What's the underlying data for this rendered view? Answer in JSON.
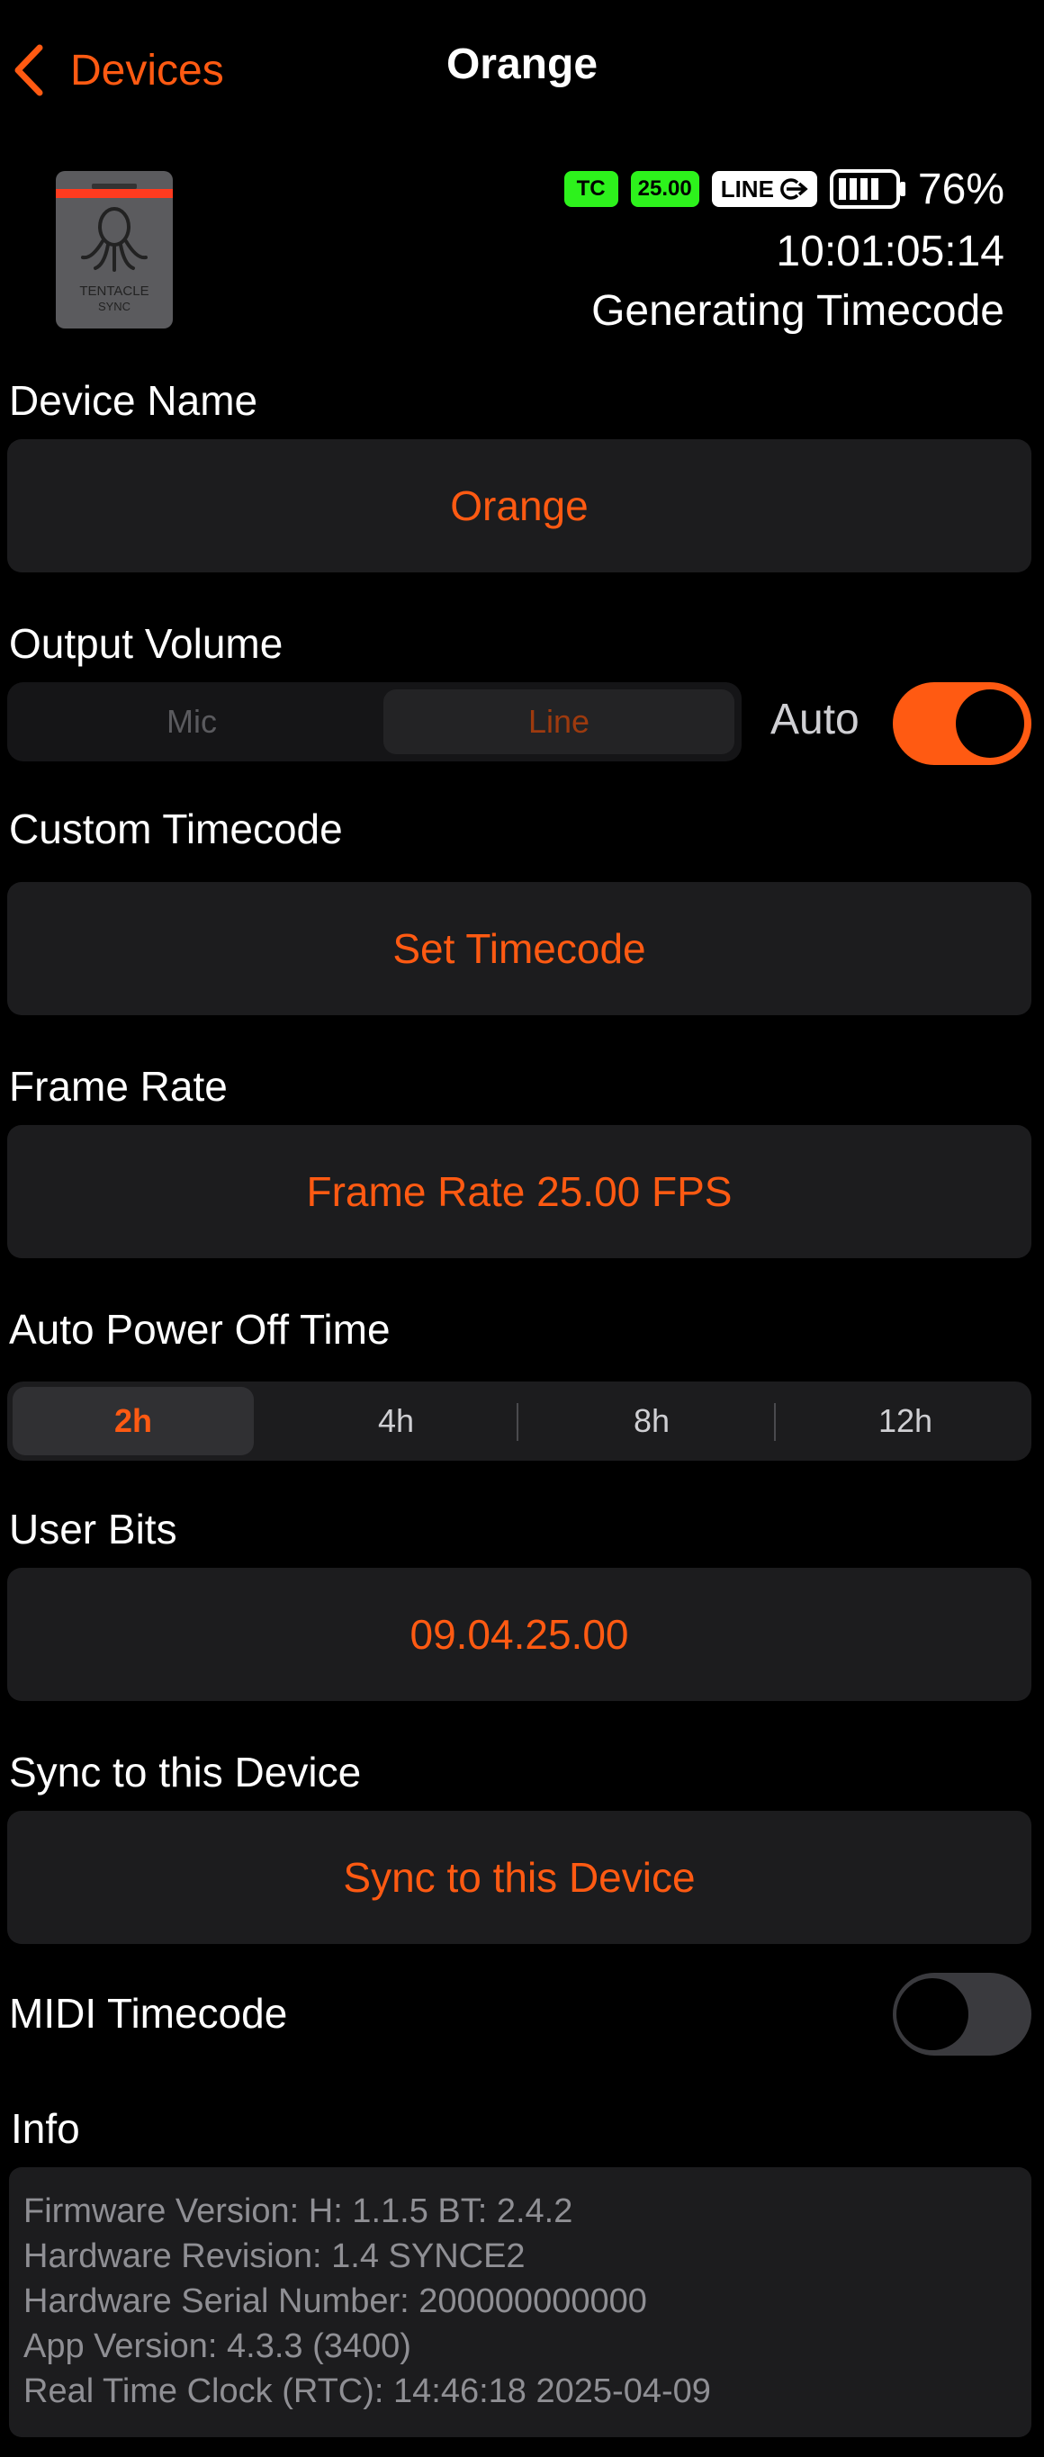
{
  "nav": {
    "back_label": "Devices",
    "title": "Orange"
  },
  "device": {
    "tc_badge": "TC",
    "fps_badge": "25.00",
    "line_badge": "LINE",
    "battery_percent": "76%",
    "timecode": "10:01:05:14",
    "status": "Generating Timecode",
    "logo_text_1": "TENTACLE",
    "logo_text_2": "SYNC"
  },
  "sections": {
    "device_name": {
      "label": "Device Name",
      "value": "Orange"
    },
    "output_volume": {
      "label": "Output Volume",
      "options": [
        "Mic",
        "Line"
      ],
      "selected": "Line",
      "auto_label": "Auto",
      "auto_on": true
    },
    "custom_timecode": {
      "label": "Custom Timecode",
      "button": "Set Timecode"
    },
    "frame_rate": {
      "label": "Frame Rate",
      "button": "Frame Rate 25.00 FPS"
    },
    "auto_power": {
      "label": "Auto Power Off Time",
      "options": [
        "2h",
        "4h",
        "8h",
        "12h"
      ],
      "selected": "2h"
    },
    "user_bits": {
      "label": "User Bits",
      "value": "09.04.25.00"
    },
    "sync": {
      "label": "Sync to this Device",
      "button": "Sync to this Device"
    },
    "midi": {
      "label": "MIDI Timecode",
      "on": false
    },
    "info": {
      "label": "Info",
      "lines": [
        "Firmware Version: H: 1.1.5 BT: 2.4.2",
        "Hardware Revision: 1.4 SYNCE2",
        "Hardware Serial Number: 200000000000",
        "App Version: 4.3.3 (3400)",
        "Real Time Clock (RTC): 14:46:18 2025-04-09"
      ]
    }
  },
  "colors": {
    "accent": "#ff5a12",
    "badge_green": "#2df21c",
    "card_bg": "#1c1c1e",
    "background": "#000000"
  }
}
